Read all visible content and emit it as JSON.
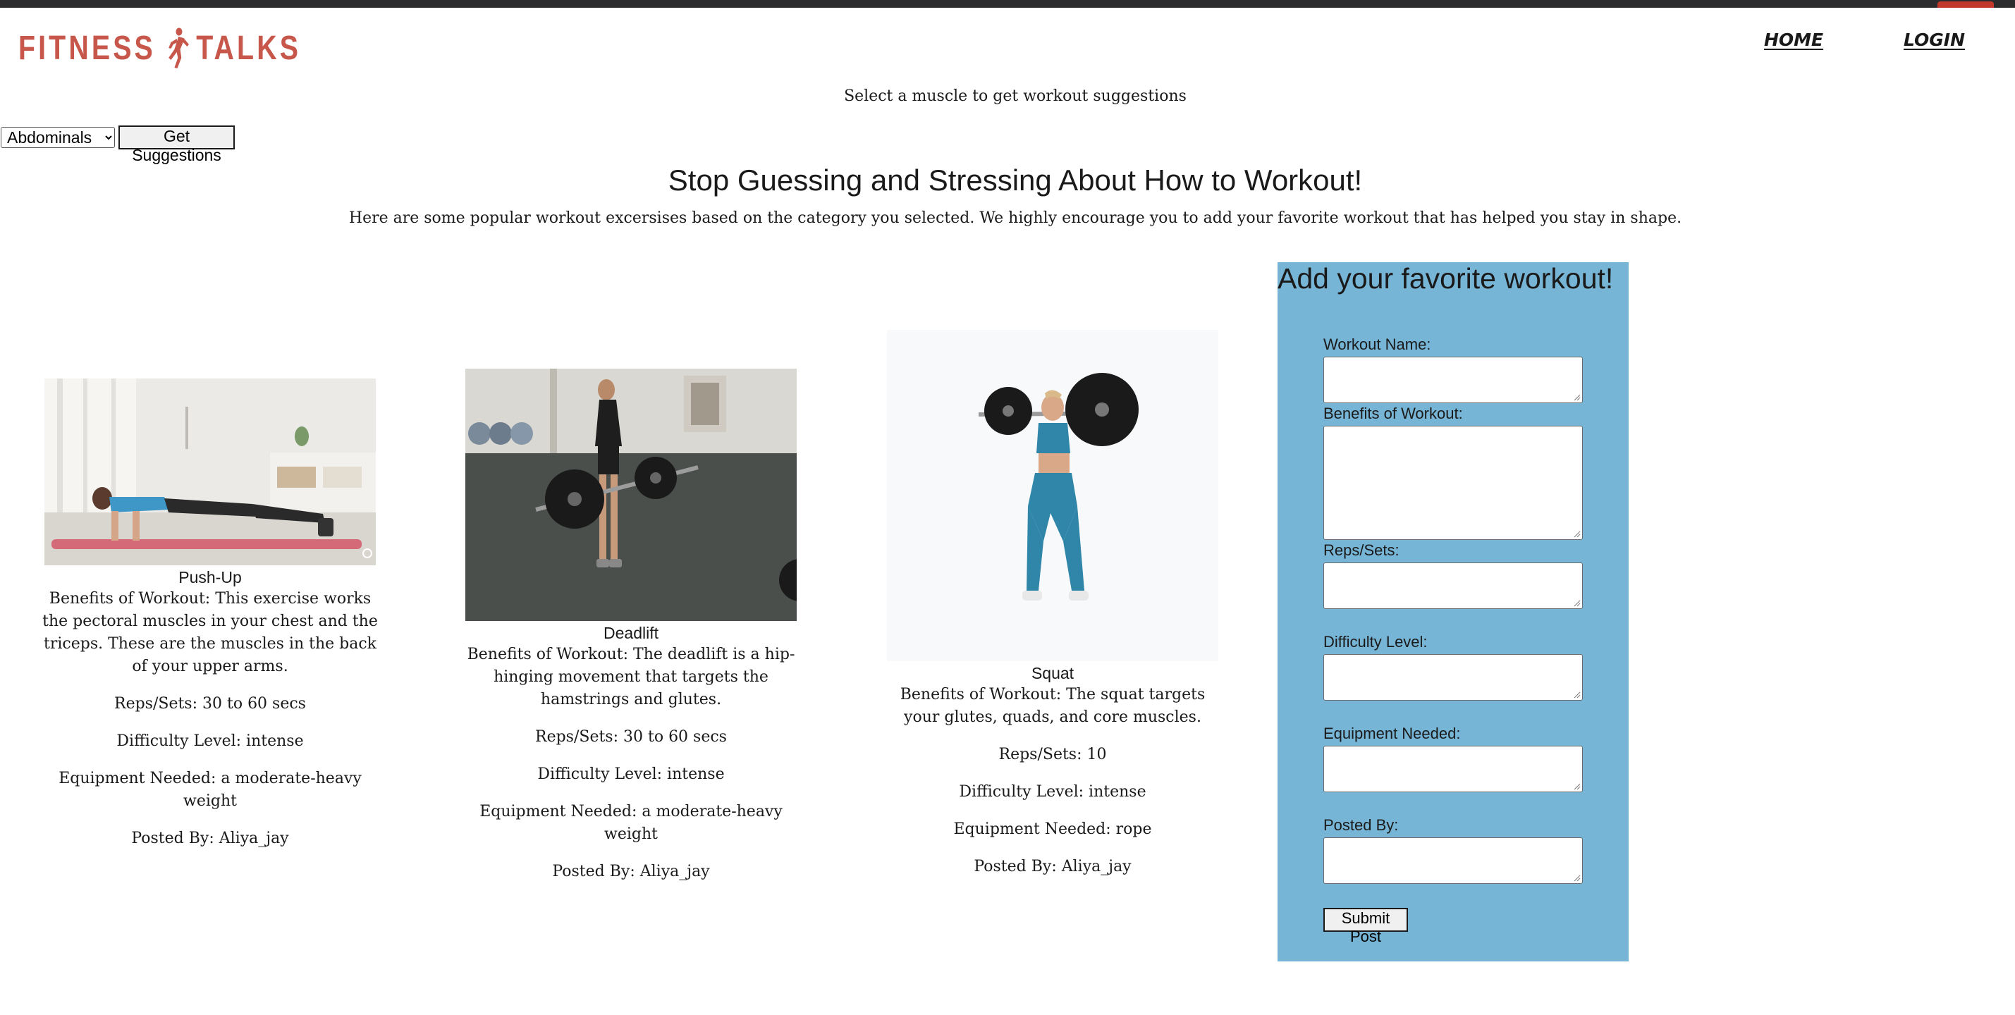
{
  "header": {
    "logo_left": "FITNESS",
    "logo_right": "TALKS",
    "nav": {
      "home": "HOME",
      "login": "LOGIN"
    }
  },
  "selector": {
    "prompt": "Select a muscle to get workout suggestions",
    "selected_muscle": "Abdominals",
    "button_label": "Get Suggestions"
  },
  "main": {
    "headline": "Stop Guessing and Stressing About How to Workout!",
    "intro": "Here are some popular workout excersises based on the category you selected. We highly encourage you to add your favorite workout that has helped you stay in shape."
  },
  "workouts": [
    {
      "name": "Push-Up",
      "benefits": "Benefits of Workout: This exercise works the pectoral muscles in your chest and the triceps. These are the muscles in the back of your upper arms.",
      "reps": "Reps/Sets: 30 to 60 secs",
      "difficulty": "Difficulty Level: intense",
      "equipment": "Equipment Needed: a moderate-heavy weight",
      "posted_by": "Posted By: Aliya_jay"
    },
    {
      "name": "Deadlift",
      "benefits": "Benefits of Workout: The deadlift is a hip-hinging movement that targets the hamstrings and glutes.",
      "reps": "Reps/Sets: 30 to 60 secs",
      "difficulty": "Difficulty Level: intense",
      "equipment": "Equipment Needed: a moderate-heavy weight",
      "posted_by": "Posted By: Aliya_jay"
    },
    {
      "name": "Squat",
      "benefits": "Benefits of Workout: The squat targets your glutes, quads, and core muscles.",
      "reps": "Reps/Sets: 10",
      "difficulty": "Difficulty Level: intense",
      "equipment": "Equipment Needed: rope",
      "posted_by": "Posted By: Aliya_jay"
    }
  ],
  "form": {
    "title": "Add your favorite workout!",
    "labels": {
      "workout_name": "Workout Name:",
      "benefits": "Benefits of Workout:",
      "reps": "Reps/Sets:",
      "difficulty": "Difficulty Level:",
      "equipment": "Equipment Needed:",
      "posted_by": "Posted By:"
    },
    "submit_label": "Submit Post"
  },
  "colors": {
    "brand": "#c6574a",
    "form_panel": "#77b5d6"
  }
}
